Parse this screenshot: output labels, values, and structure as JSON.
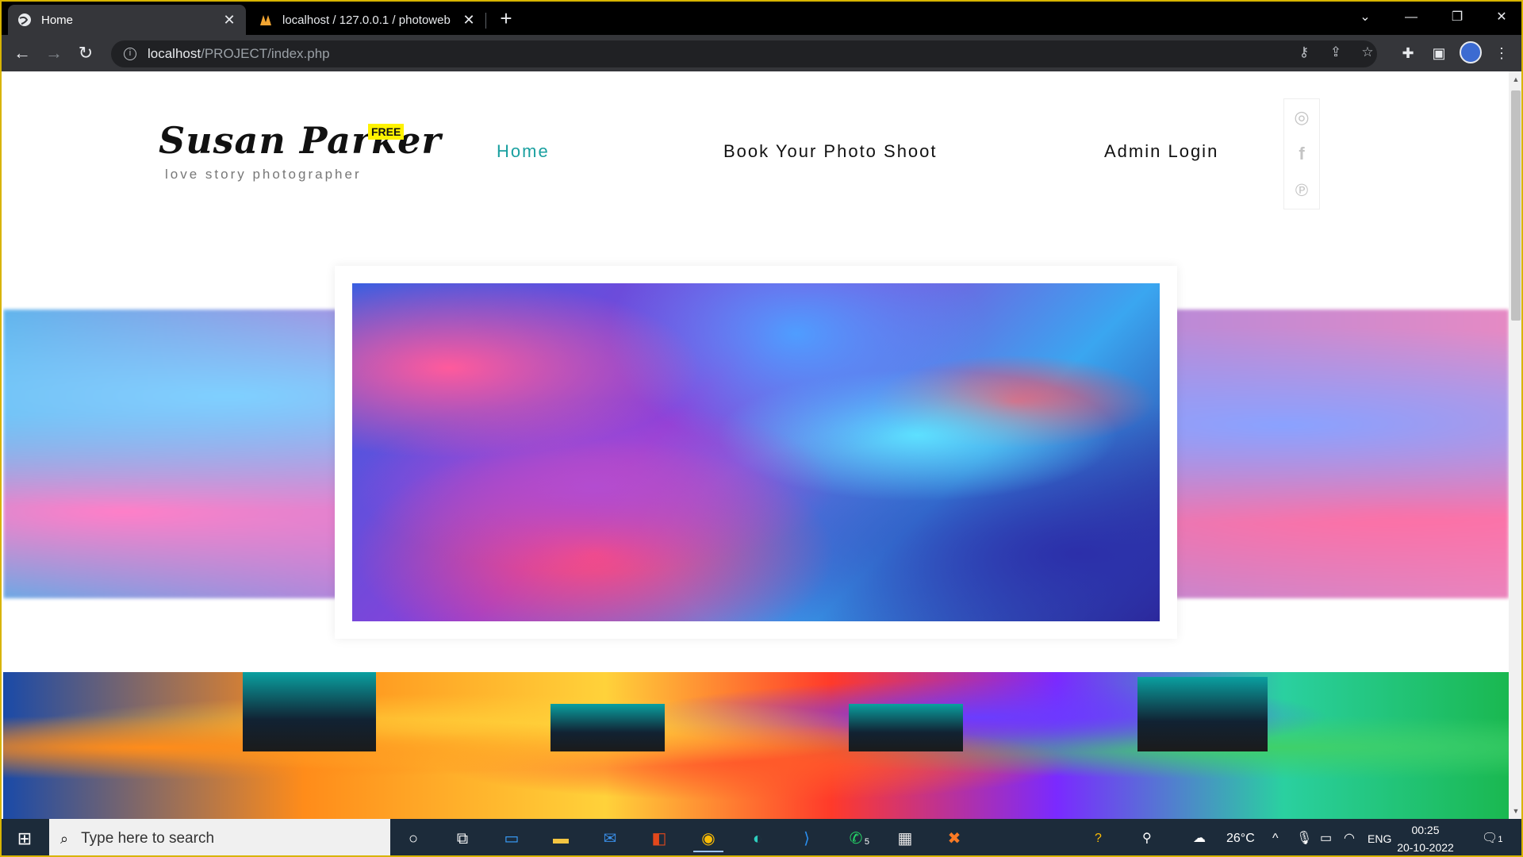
{
  "browser": {
    "tabs": [
      {
        "title": "Home",
        "active": true
      },
      {
        "title": "localhost / 127.0.0.1 / photoweb",
        "active": false
      }
    ],
    "url_host": "localhost",
    "url_path": "/PROJECT/index.php"
  },
  "site": {
    "logo_name": "Susan Parker",
    "logo_badge": "FREE",
    "logo_tagline": "love story photographer",
    "nav": [
      {
        "label": "Home",
        "active": true
      },
      {
        "label": "Book Your Photo Shoot",
        "active": false
      },
      {
        "label": "Admin Login",
        "active": false
      }
    ],
    "social": [
      "instagram-icon",
      "facebook-icon",
      "pinterest-icon"
    ],
    "accent_color": "#1aa0a0"
  },
  "taskbar": {
    "search_placeholder": "Type here to search",
    "whatsapp_badge": "5",
    "weather": "26°C",
    "language": "ENG",
    "time": "00:25",
    "date": "20-10-2022",
    "notification_count": "1"
  }
}
